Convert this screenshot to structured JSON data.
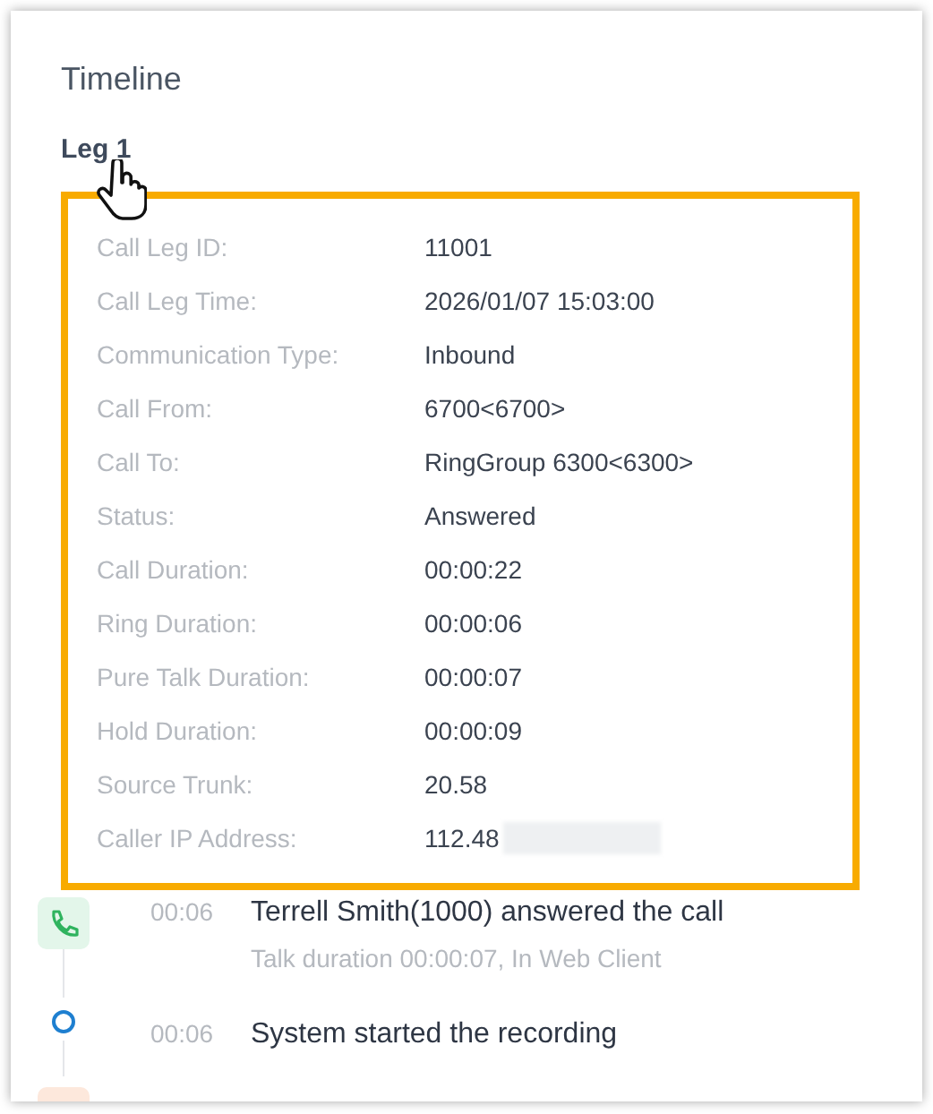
{
  "title": "Timeline",
  "leg": {
    "label": "Leg 1"
  },
  "details": [
    {
      "label": "Call Leg ID:",
      "value": "11001"
    },
    {
      "label": "Call Leg Time:",
      "value": "2026/01/07 15:03:00"
    },
    {
      "label": "Communication Type:",
      "value": "Inbound"
    },
    {
      "label": "Call From:",
      "value": "6700<6700>"
    },
    {
      "label": "Call To:",
      "value": "RingGroup 6300<6300>"
    },
    {
      "label": "Status:",
      "value": "Answered"
    },
    {
      "label": "Call Duration:",
      "value": "00:00:22"
    },
    {
      "label": "Ring Duration:",
      "value": "00:00:06"
    },
    {
      "label": "Pure Talk Duration:",
      "value": "00:00:07"
    },
    {
      "label": "Hold Duration:",
      "value": "00:00:09"
    },
    {
      "label": "Source Trunk:",
      "value": "20.58"
    },
    {
      "label": "Caller IP Address:",
      "value": "112.48",
      "redacted": true
    }
  ],
  "events": [
    {
      "kind": "answered",
      "time": "00:06",
      "text": "Terrell Smith(1000) answered the call",
      "detail": "Talk duration 00:00:07, In Web Client"
    },
    {
      "kind": "recording",
      "time": "00:06",
      "text": "System started the recording"
    },
    {
      "kind": "warning"
    }
  ]
}
